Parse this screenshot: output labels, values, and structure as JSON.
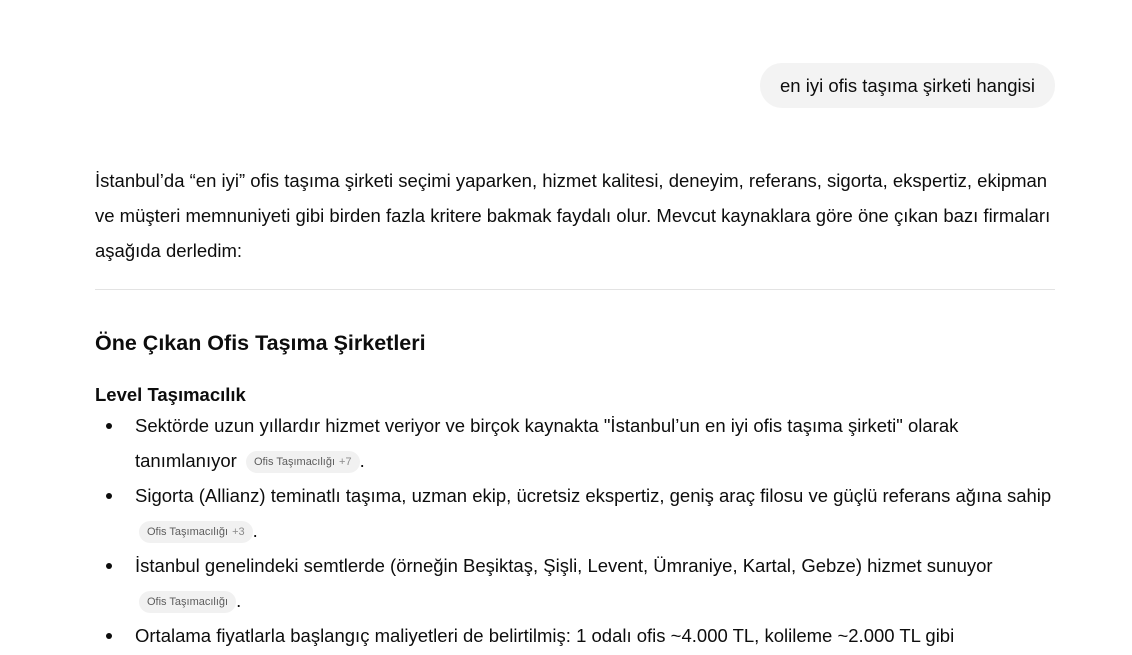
{
  "user_message": "en iyi ofis taşıma şirketi hangisi",
  "answer": {
    "intro": "İstanbul’da “en iyi” ofis taşıma şirketi seçimi yaparken, hizmet kalitesi, deneyim, referans, sigorta, ekspertiz, ekipman ve müşteri memnuniyeti gibi birden fazla kritere bakmak faydalı olur. Mevcut kaynaklara göre öne çıkan bazı firmaları aşağıda derledim:",
    "section_title": "Öne Çıkan Ofis Taşıma Şirketleri",
    "company": {
      "name": "Level Taşımacılık",
      "bullets": [
        {
          "text": "Sektörde uzun yıllardır hizmet veriyor ve birçok kaynakta \"İstanbul’un en iyi ofis taşıma şirketi\" olarak tanımlanıyor",
          "chip_label": "Ofis Taşımacılığı",
          "chip_count": "+7",
          "end": "."
        },
        {
          "text": "Sigorta (Allianz) teminatlı taşıma, uzman ekip, ücretsiz ekspertiz, geniş araç filosu ve güçlü referans ağına sahip",
          "chip_label": "Ofis Taşımacılığı",
          "chip_count": "+3",
          "end": "."
        },
        {
          "text": "İstanbul genelindeki semtlerde (örneğin Beşiktaş, Şişli, Levent, Ümraniye, Kartal, Gebze) hizmet sunuyor",
          "chip_label": "Ofis Taşımacılığı",
          "chip_count": "",
          "end": "."
        },
        {
          "text": "Ortalama fiyatlarla başlangıç maliyetleri de belirtilmiş: 1 odalı ofis ~4.000 TL, kolileme ~2.000 TL gibi",
          "chip_label": "",
          "chip_count": "",
          "end": ""
        }
      ]
    }
  }
}
